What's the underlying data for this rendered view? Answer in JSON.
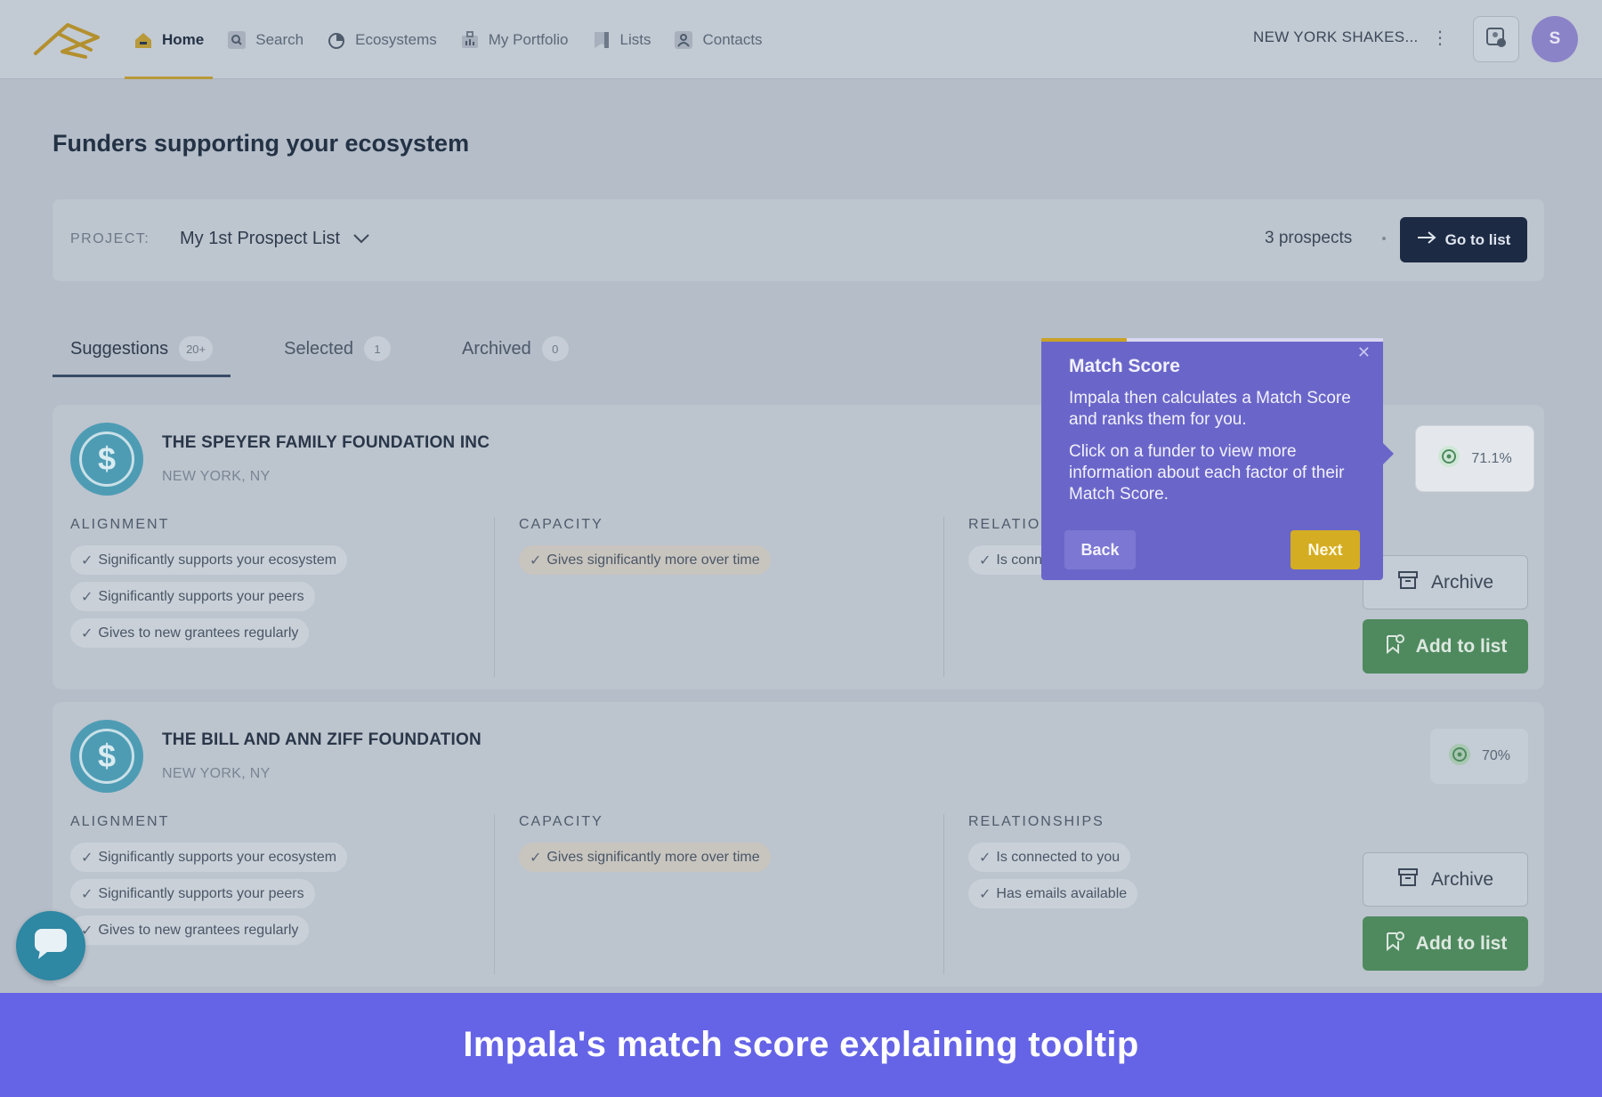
{
  "nav": {
    "items": [
      {
        "label": "Home",
        "icon": "home-icon",
        "active": true
      },
      {
        "label": "Search",
        "icon": "search-icon",
        "active": false
      },
      {
        "label": "Ecosystems",
        "icon": "ecosystems-icon",
        "active": false
      },
      {
        "label": "My Portfolio",
        "icon": "portfolio-icon",
        "active": false
      },
      {
        "label": "Lists",
        "icon": "bookmark-icon",
        "active": false
      },
      {
        "label": "Contacts",
        "icon": "contacts-icon",
        "active": false
      }
    ],
    "org_name": "NEW YORK SHAKES...",
    "avatar_initial": "S"
  },
  "page": {
    "title": "Funders supporting your ecosystem"
  },
  "project": {
    "label": "PROJECT:",
    "value": "My 1st Prospect List",
    "prospects": "3 prospects",
    "go_button": "Go to list"
  },
  "tabs": [
    {
      "label": "Suggestions",
      "count": "20+",
      "active": true
    },
    {
      "label": "Selected",
      "count": "1",
      "active": false
    },
    {
      "label": "Archived",
      "count": "0",
      "active": false
    }
  ],
  "funders": [
    {
      "name": "THE SPEYER FAMILY FOUNDATION INC",
      "location": "NEW YORK, NY",
      "score": "71.1%",
      "alignment_head": "ALIGNMENT",
      "alignment": [
        "Significantly supports your ecosystem",
        "Significantly supports your peers",
        "Gives to new grantees regularly"
      ],
      "capacity_head": "CAPACITY",
      "capacity": [
        "Gives significantly more over time"
      ],
      "relationships_head": "RELATIONSHIPS",
      "relationships": [
        "Is connected to you"
      ],
      "archive_label": "Archive",
      "add_label": "Add to list"
    },
    {
      "name": "THE BILL AND ANN ZIFF FOUNDATION",
      "location": "NEW YORK, NY",
      "score": "70%",
      "alignment_head": "ALIGNMENT",
      "alignment": [
        "Significantly supports your ecosystem",
        "Significantly supports your peers",
        "Gives to new grantees regularly"
      ],
      "capacity_head": "CAPACITY",
      "capacity": [
        "Gives significantly more over time"
      ],
      "relationships_head": "RELATIONSHIPS",
      "relationships": [
        "Is connected to you",
        "Has emails available"
      ],
      "archive_label": "Archive",
      "add_label": "Add to list"
    }
  ],
  "tooltip": {
    "title": "Match Score",
    "body": [
      "Impala then calculates a Match Score and ranks them for you.",
      "Click on a funder to view more information about each factor of their Match Score."
    ],
    "back": "Back",
    "next": "Next",
    "step_progress": 0.25
  },
  "caption": "Impala's match score explaining tooltip",
  "colors": {
    "accent_gold": "#c9a227",
    "tooltip_purple": "#6a66c9",
    "add_green": "#4f8a5f",
    "navy_button": "#1c2a44",
    "banner_purple": "#6564e7"
  }
}
